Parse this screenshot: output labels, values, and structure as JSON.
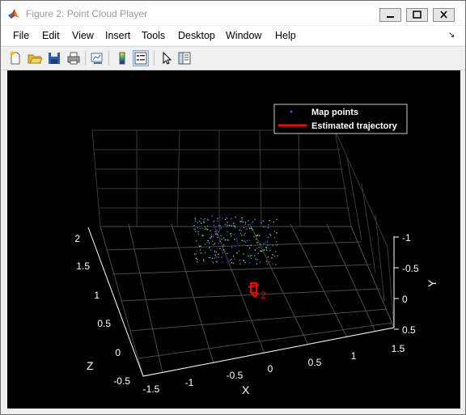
{
  "window": {
    "title": "Figure 2: Point Cloud Player",
    "icons": [
      "matlab-logo-icon",
      "minimize-icon",
      "maximize-icon",
      "close-icon"
    ]
  },
  "menu": [
    "File",
    "Edit",
    "View",
    "Insert",
    "Tools",
    "Desktop",
    "Window",
    "Help"
  ],
  "menu_dock_glyph": "↘",
  "toolbar": {
    "buttons": [
      "new-figure-icon",
      "open-file-icon",
      "save-icon",
      "print-icon",
      "link-plot-icon",
      "colorbar-icon",
      "legend-icon",
      "edit-plot-icon",
      "property-inspector-icon"
    ],
    "active": "legend-icon"
  },
  "plot": {
    "legend": [
      "Map points",
      "Estimated trajectory"
    ],
    "legend_colors": [
      "#3b5bd6",
      "#ff0000"
    ],
    "x_ticks": [
      "-1.5",
      "-1",
      "-0.5",
      "0",
      "0.5",
      "1",
      "1.5"
    ],
    "x_label": "X",
    "y_ticks": [
      "-1",
      "-0.5",
      "0",
      "0.5"
    ],
    "y_label": "Y",
    "z_ticks": [
      "2",
      "1.5",
      "1",
      "0.5",
      "0",
      "-0.5"
    ],
    "z_label": "Z",
    "camera_label": "2",
    "trajectory_color": "#ff0000"
  }
}
